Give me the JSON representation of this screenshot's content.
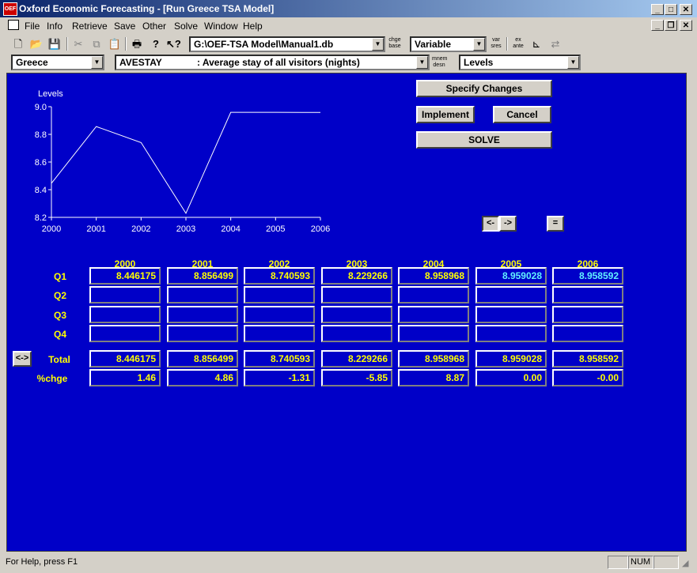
{
  "window": {
    "app_icon": "OEF",
    "title": "Oxford Economic Forecasting - [Run Greece TSA Model]"
  },
  "menu": [
    "File",
    "Info",
    "Retrieve",
    "Save",
    "Other",
    "Solve",
    "Window",
    "Help"
  ],
  "toolbar": {
    "db_path": "G:\\OEF-TSA Model\\Manual1.db",
    "chge_base": [
      "chge",
      "base"
    ],
    "variable_mode": "Variable",
    "var_sres": [
      "var",
      "sres"
    ],
    "ex_ante": [
      "ex",
      "ante"
    ]
  },
  "toolbar2": {
    "country": "Greece",
    "variable_code": "AVESTAY",
    "variable_desc": ": Average stay of all visitors (nights)",
    "mnem_desn": [
      "mnem",
      "desn"
    ],
    "display_mode": "Levels"
  },
  "buttons": {
    "specify_changes": "Specify Changes",
    "implement": "Implement",
    "cancel": "Cancel",
    "solve": "SOLVE",
    "back": "<-",
    "forward": "->",
    "equals": "=",
    "swap": "<->"
  },
  "chart_data": {
    "type": "line",
    "ylabel": "Levels",
    "x": [
      2000,
      2001,
      2002,
      2003,
      2004,
      2005,
      2006
    ],
    "series": [
      {
        "values": [
          8.446175,
          8.856499,
          8.740593,
          8.229266,
          8.958968,
          8.959028,
          8.958592
        ]
      }
    ],
    "ylim": [
      8.2,
      9.0
    ],
    "yticks": [
      "8.2",
      "8.4",
      "8.6",
      "8.8",
      "9.0"
    ],
    "xticks": [
      "2000",
      "2001",
      "2002",
      "2003",
      "2004",
      "2005",
      "2006"
    ],
    "line_color": "#ffffff",
    "grid": false
  },
  "table": {
    "years": [
      "2000",
      "2001",
      "2002",
      "2003",
      "2004",
      "2005",
      "2006"
    ],
    "q1_label": "Q1",
    "q2_label": "Q2",
    "q3_label": "Q3",
    "q4_label": "Q4",
    "total_label": "Total",
    "chge_label": "%chge",
    "q1": [
      "8.446175",
      "8.856499",
      "8.740593",
      "8.229266",
      "8.958968",
      "8.959028",
      "8.958592"
    ],
    "q2": [
      "",
      "",
      "",
      "",
      "",
      "",
      ""
    ],
    "q3": [
      "",
      "",
      "",
      "",
      "",
      "",
      ""
    ],
    "q4": [
      "",
      "",
      "",
      "",
      "",
      "",
      ""
    ],
    "total": [
      "8.446175",
      "8.856499",
      "8.740593",
      "8.229266",
      "8.958968",
      "8.959028",
      "8.958592"
    ],
    "chge": [
      "1.46",
      "4.86",
      "-1.31",
      "-5.85",
      "8.87",
      "0.00",
      "-0.00"
    ],
    "forecast_color": "#60f0ff",
    "value_color": "#ffff00"
  },
  "status": {
    "message": "For Help, press F1",
    "num": "NUM"
  }
}
